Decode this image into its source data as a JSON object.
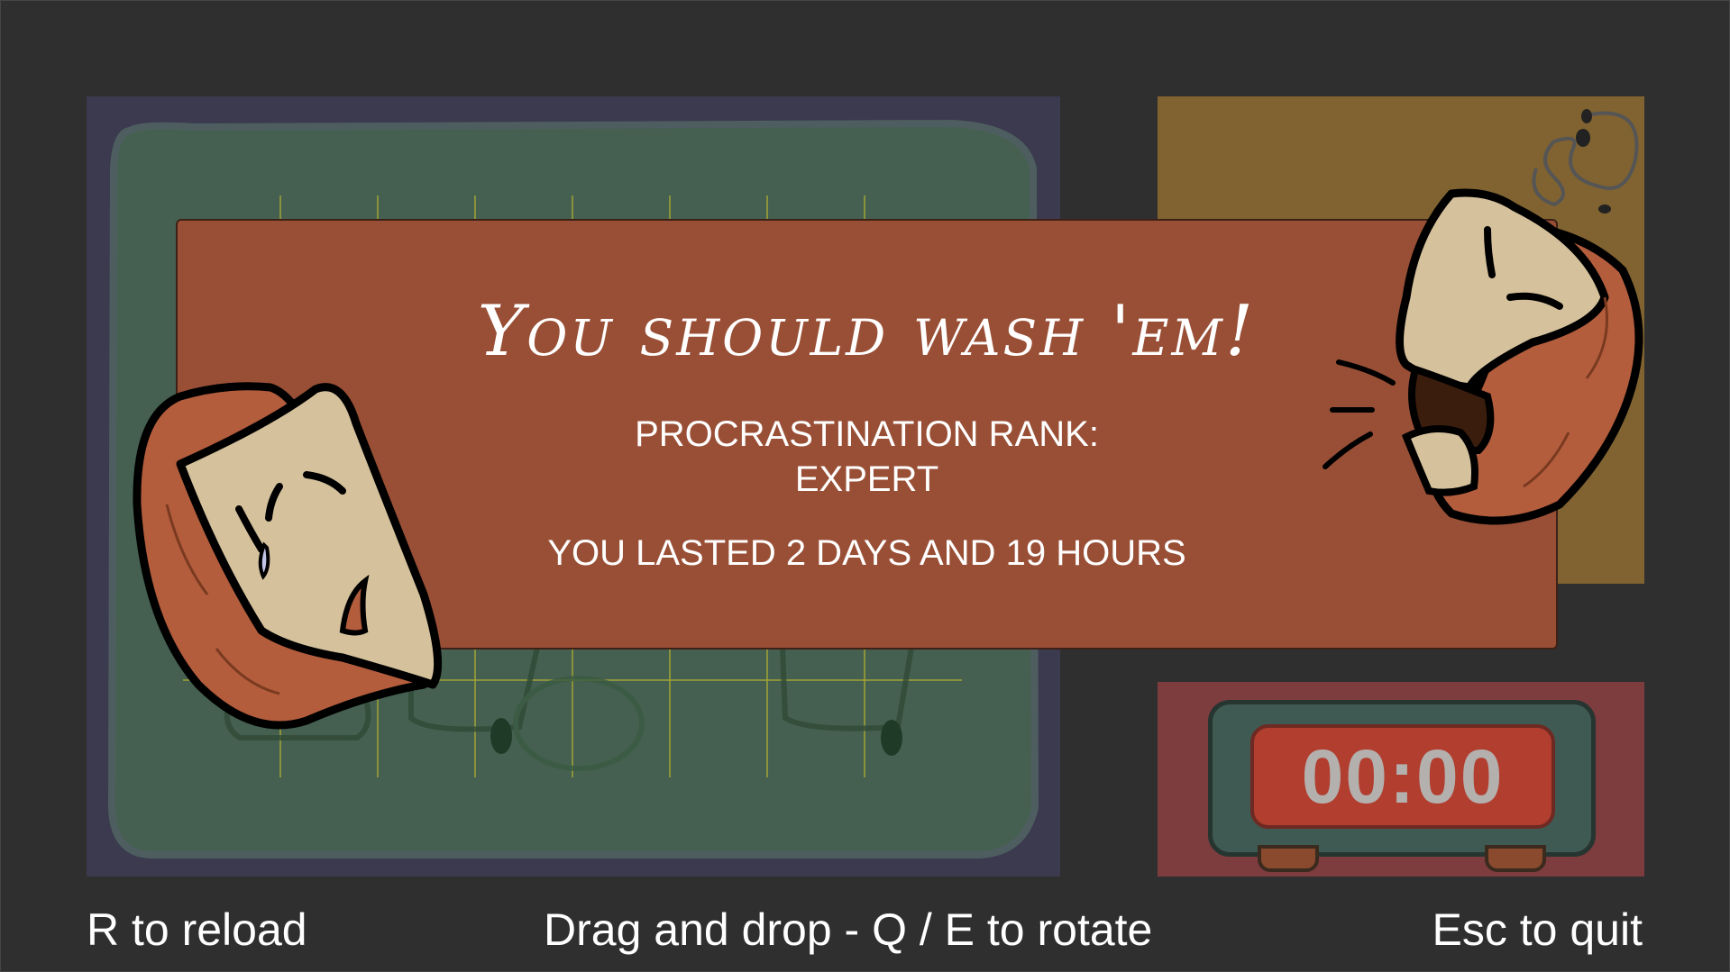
{
  "result": {
    "title": "You should wash 'em!",
    "rank_label": "PROCRASTINATION RANK:",
    "rank_value": "EXPERT",
    "duration": "YOU LASTED 2 DAYS AND 19 HOURS"
  },
  "timer": {
    "display": "00:00"
  },
  "hints": {
    "reload": "R to reload",
    "controls": "Drag and drop - Q / E to rotate",
    "quit": "Esc to quit"
  },
  "colors": {
    "background": "#2f2f2f",
    "board_panel": "#3b3a4f",
    "board_surface": "#456050",
    "fly_panel": "#806330",
    "timer_panel": "#7d3c3e",
    "result_card": "#994f36",
    "timer_display": "#b13e2f"
  },
  "icons": {
    "sad_character": "crying-hooded-face",
    "yelling_character": "yelling-hooded-face",
    "fly": "buzzing-fly-icon"
  }
}
